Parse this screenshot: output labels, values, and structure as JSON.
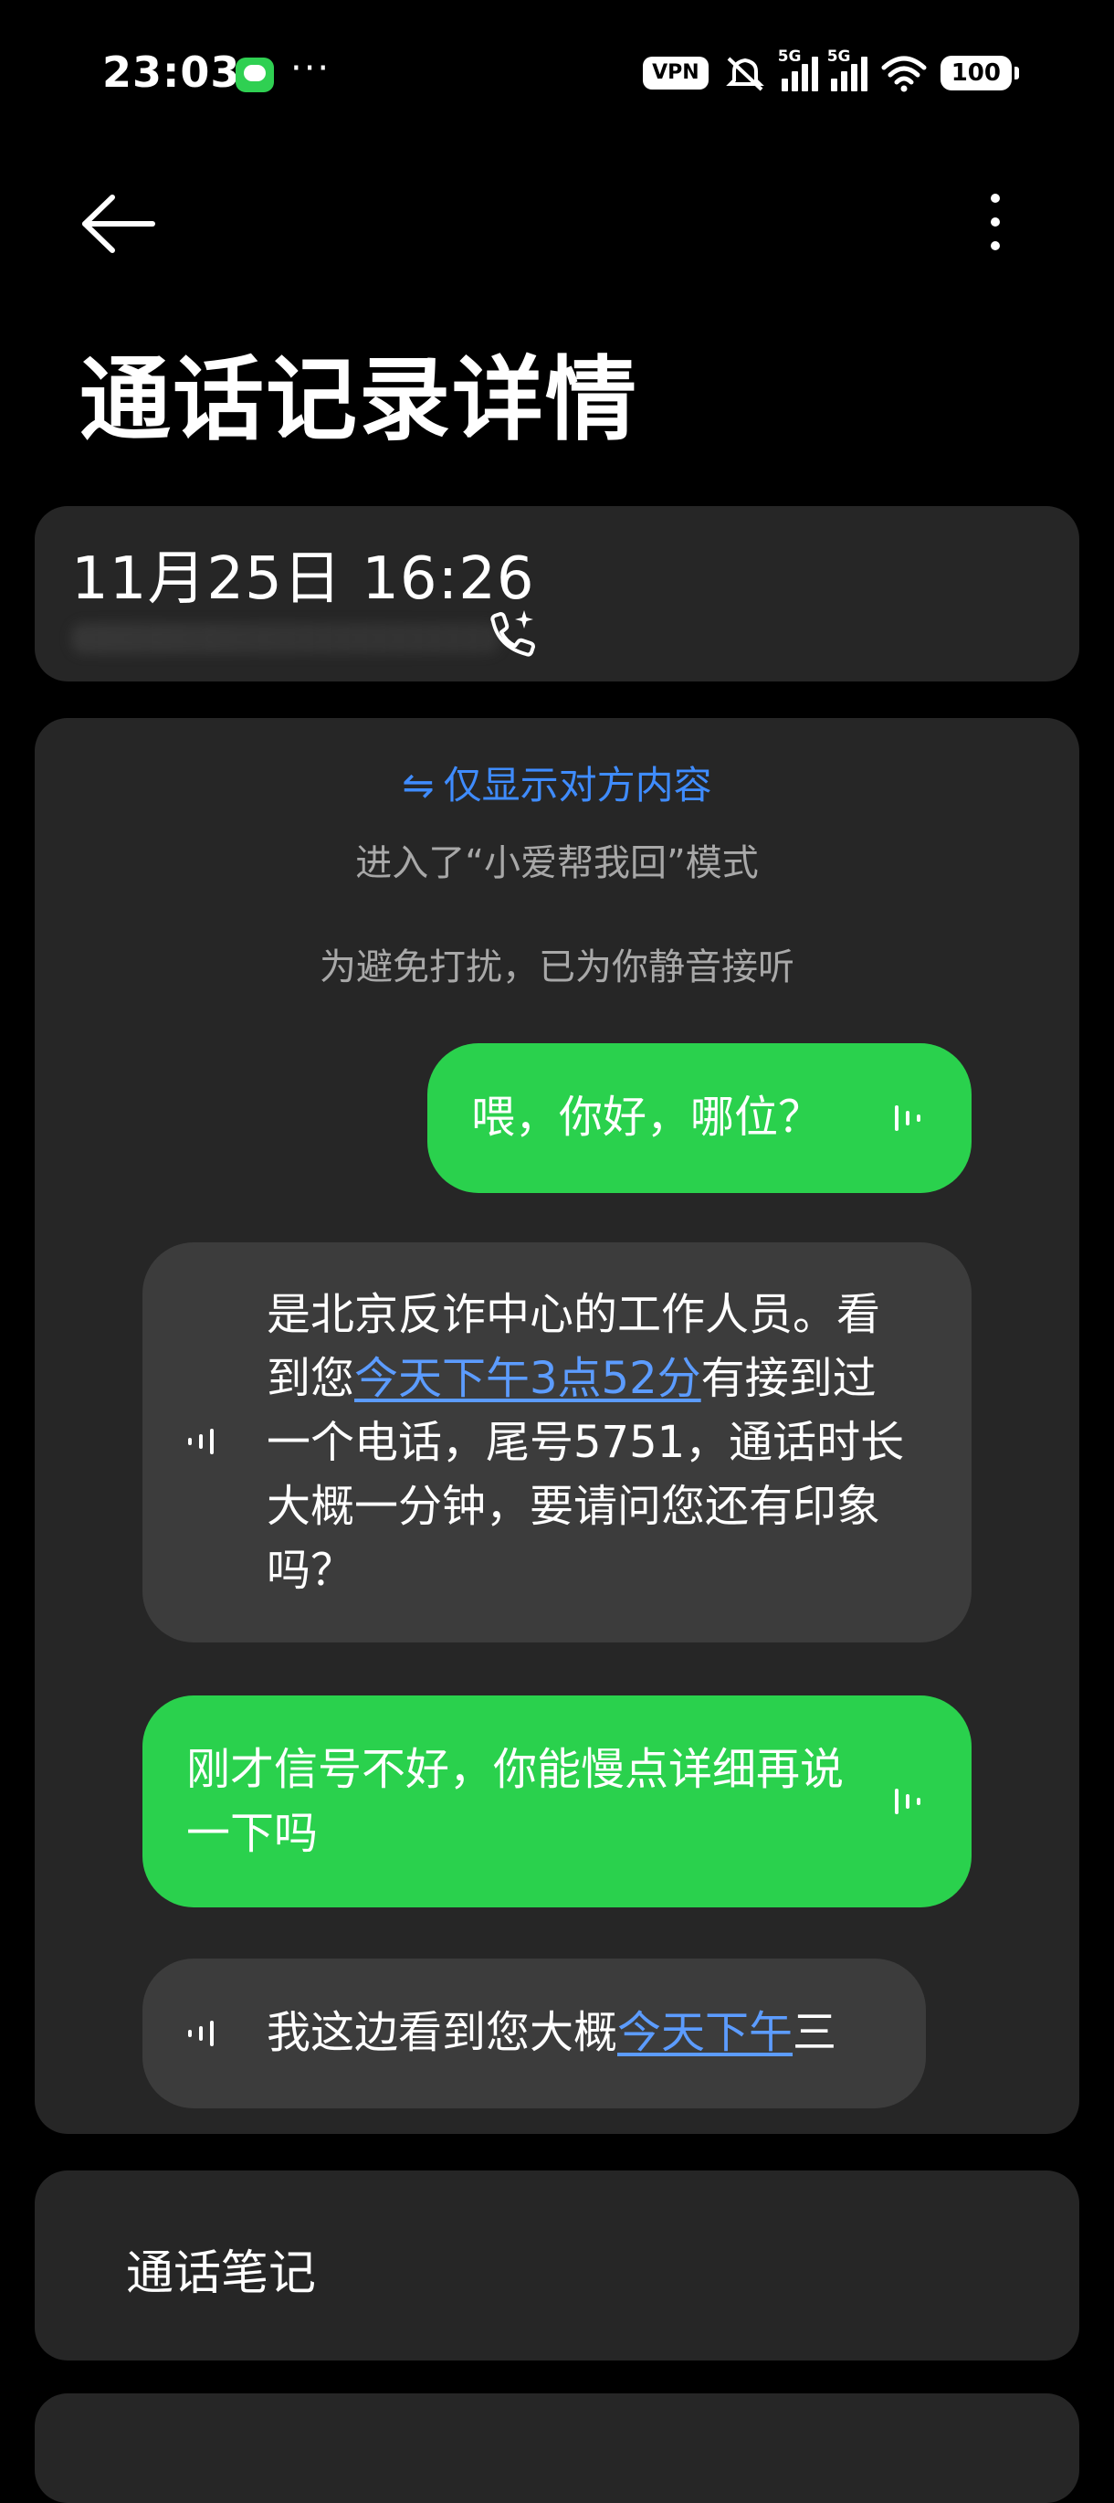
{
  "status_bar": {
    "time": "23:03",
    "vpn": "VPN",
    "battery": "100",
    "network1": "5G",
    "network2": "5G",
    "icons": [
      "message-icon",
      "more-dots-icon",
      "vpn-icon",
      "mute-icon",
      "signal-icon",
      "wifi-icon",
      "battery-icon"
    ]
  },
  "app_bar": {
    "back_icon": "back-arrow-icon",
    "menu_icon": "more-vertical-icon"
  },
  "page": {
    "title": "通话记录详情"
  },
  "call_info": {
    "datetime": "11月25日 16:26",
    "ai_icon": "ai-call-icon"
  },
  "chat": {
    "toggle_icon": "swap-icon",
    "toggle_label": "仅显示对方内容",
    "system_line_1": "进入了“小爱帮我回”模式",
    "system_line_2": "为避免打扰，已为你静音接听",
    "messages": [
      {
        "side": "me",
        "text": "喂，你好，哪位？"
      },
      {
        "side": "them",
        "text_a": "是北京反诈中心的工作人员。看到您",
        "text_link": "今天下午3点52分",
        "text_b": "有接到过一个电话，尾号5751，通话时长大概一分钟，要请问您还有印象吗？"
      },
      {
        "side": "me",
        "text": "刚才信号不好，你能慢点详细再说一下吗"
      },
      {
        "side": "them",
        "text_a": "我这边看到您大概",
        "text_link": "今天下午",
        "text_b": "三"
      }
    ]
  },
  "notes": {
    "label": "通话笔记"
  },
  "colors": {
    "background": "#000000",
    "card": "#262626",
    "my_bubble": "#2ad14d",
    "their_bubble": "#3c3c3c",
    "link": "#5c9cff",
    "accent": "#3f8cff"
  }
}
